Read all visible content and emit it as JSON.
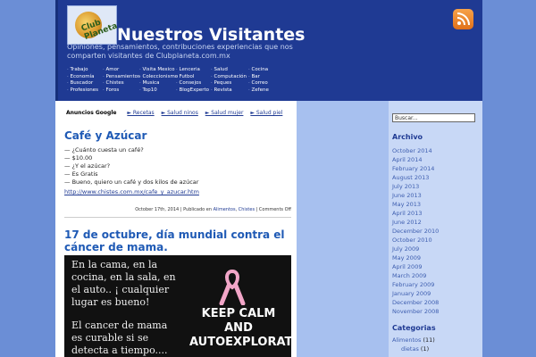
{
  "header": {
    "logo_text": "Club Planeta",
    "title": "Nuestros Visitantes",
    "tagline": "Opiniones, pensamientos, contribuciones experiencias que nos comparten visitantes de Clubplaneta.com.mx"
  },
  "nav": {
    "col1": [
      "Trabajo",
      "Economía",
      "Buscador",
      "Profesiones"
    ],
    "col2": [
      "Amor",
      "Pensamientos",
      "Chistes",
      "Foros"
    ],
    "col3": [
      "Visita Mexico",
      "Coleccionismo",
      "Musica",
      "Top10"
    ],
    "col4": [
      "Lenceria",
      "Futbol",
      "Consejos",
      "BlogExperto"
    ],
    "col5": [
      "Salud",
      "Computación",
      "Peques",
      "Revista"
    ],
    "col6": [
      "Cocina",
      "Bar",
      "Correo",
      "Zefene"
    ]
  },
  "ads": {
    "label": "Anuncios Google",
    "links": [
      "► Recetas",
      "► Salud ninos",
      "► Salud mujer",
      "► Salud piel"
    ]
  },
  "post1": {
    "title": "Café y Azúcar",
    "lines": [
      "— ¿Cuánto cuesta un café?",
      "— $10.00",
      "— ¿Y el azúcar?",
      "— Es Gratis",
      "— Bueno, quiero un café y dos kilos de azúcar"
    ],
    "link": "http://www.chistes.com.mx/cafe_y_azucar.htm",
    "meta_date": "October 17th, 2014 | Publicado en ",
    "meta_cat1": "Alimentos",
    "meta_cat2": "Chistes",
    "meta_comments": " | Comments Off"
  },
  "post2": {
    "title": "17 de octubre, día mundial contra el cáncer de mama.",
    "banner_text1": "En la cama, en la cocina, en la sala, en el auto.. ¡ cualquier lugar es bueno!",
    "banner_text2": "El cancer de mama es curable si se detecta a tiempo....",
    "banner_slogan": "KEEP CALM AND AUTOEXPLORATE"
  },
  "sidebar": {
    "search_placeholder": "Buscar...",
    "archive_heading": "Archivo",
    "archive": [
      "October 2014",
      "April 2014",
      "February 2014",
      "August 2013",
      "July 2013",
      "June 2013",
      "May 2013",
      "April 2013",
      "June 2012",
      "December 2010",
      "October 2010",
      "July 2009",
      "May 2009",
      "April 2009",
      "March 2009",
      "February 2009",
      "January 2009",
      "December 2008",
      "November 2008"
    ],
    "categories_heading": "Categorias",
    "categories": [
      {
        "name": "Alimentos",
        "count": " (11)"
      },
      {
        "name": "dietas",
        "count": " (1)"
      }
    ]
  },
  "colors": {
    "header_bg": "#1f3a93",
    "page_bg": "#6b8ed6",
    "link": "#1f5ab5",
    "rss": "#e0701a"
  }
}
